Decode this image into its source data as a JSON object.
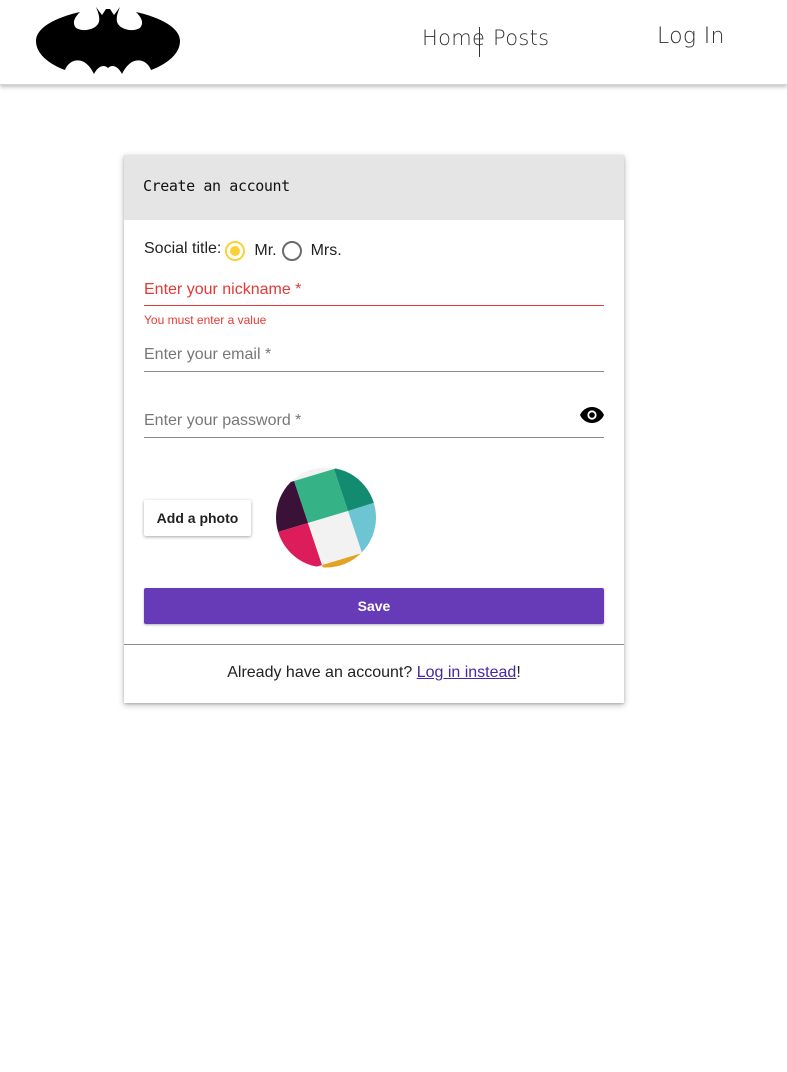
{
  "header": {
    "logo_icon": "bat-logo-icon",
    "nav": {
      "home": "Home",
      "posts": "Posts",
      "login": "Log In"
    }
  },
  "card": {
    "title": "Create an account",
    "social_title": {
      "label": "Social title:",
      "options": [
        {
          "label": "Mr.",
          "checked": true
        },
        {
          "label": "Mrs.",
          "checked": false
        }
      ]
    },
    "nickname": {
      "placeholder": "Enter your nickname *",
      "error": "You must enter a value"
    },
    "email": {
      "placeholder": "Enter your email *"
    },
    "password": {
      "placeholder": "Enter your password *",
      "toggle_icon": "eye-icon"
    },
    "add_photo_label": "Add a photo",
    "save_label": "Save",
    "footer": {
      "text": "Already have an account?",
      "link": "Log in instead",
      "suffix": "!"
    }
  },
  "colors": {
    "accent": "#673ab7",
    "error": "#e53935",
    "radio_selected": "#fbd235",
    "header_bg": "#e5e5e5"
  }
}
